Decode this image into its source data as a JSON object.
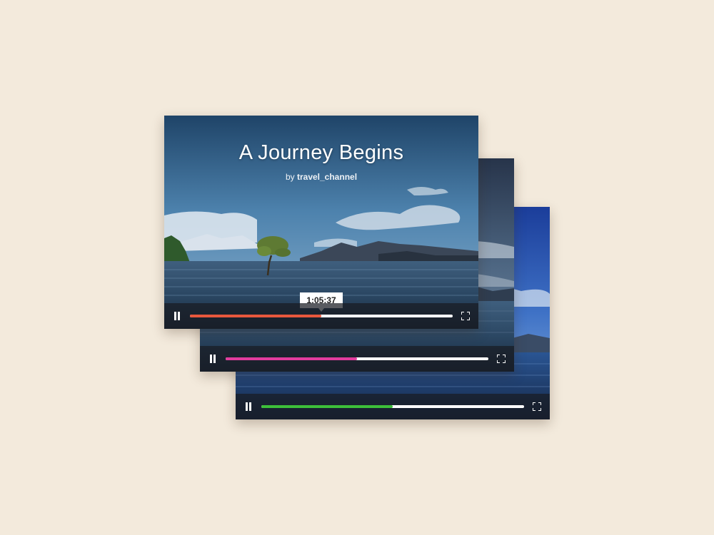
{
  "featured_video": {
    "title": "A Journey Begins",
    "byline_prefix": "by",
    "channel": "travel_channel",
    "hover_time": "1:05:37"
  },
  "players": [
    {
      "id": "front",
      "progress": 0.5,
      "accent_color": "#e8573c",
      "play_state": "playing",
      "pause_icon": "pause-icon",
      "fullscreen_icon": "fullscreen-icon"
    },
    {
      "id": "middle",
      "progress": 0.5,
      "accent_color": "#e23c9e",
      "play_state": "playing",
      "pause_icon": "pause-icon",
      "fullscreen_icon": "fullscreen-icon"
    },
    {
      "id": "back",
      "progress": 0.5,
      "accent_color": "#3dbf3a",
      "play_state": "playing",
      "pause_icon": "pause-icon",
      "fullscreen_icon": "fullscreen-icon"
    }
  ],
  "colors": {
    "page_background": "#f3eadc",
    "control_bar": "#191c22",
    "track": "#ffffff"
  }
}
